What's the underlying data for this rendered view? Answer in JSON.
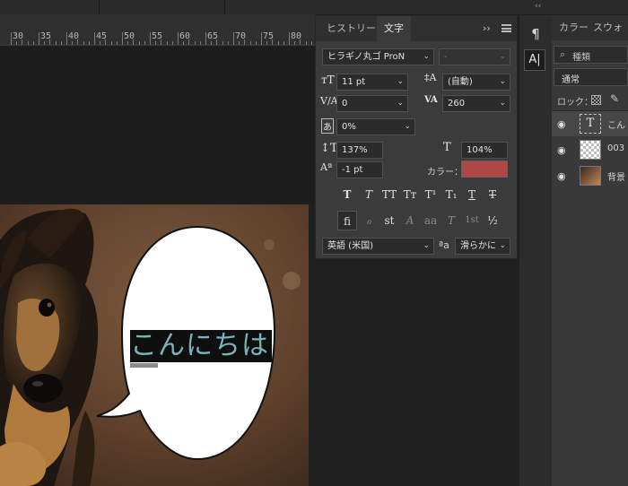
{
  "collapse_glyph": "‹‹",
  "ruler": {
    "labels": [
      "30",
      "35",
      "40",
      "45",
      "50",
      "55",
      "60",
      "65",
      "70",
      "75",
      "80"
    ]
  },
  "character_panel": {
    "tabs": {
      "history": "ヒストリー",
      "character": "文字"
    },
    "menu_glyph": "››",
    "font_family": "ヒラギノ丸ゴ ProN",
    "font_style": "-",
    "font_size": "11 pt",
    "leading": "(自動)",
    "kerning": "0",
    "tracking": "260",
    "tsume": "0%",
    "vertical_scale": "137%",
    "horizontal_scale": "104%",
    "baseline_shift": "-1 pt",
    "color_label": "カラー：",
    "text_color": "#b04646",
    "style_buttons": [
      "T",
      "T",
      "TT",
      "Tт",
      "T¹",
      "T₁",
      "T",
      "T"
    ],
    "opentype_buttons": [
      "ﬁ",
      "ℴ",
      "st",
      "A",
      "aa",
      "T",
      "1st",
      "½"
    ],
    "language": "英語 (米国)",
    "aa_label": "ªa",
    "antialias": "滑らかに"
  },
  "toolbar": {
    "tool1": "¶",
    "tool2": "A|"
  },
  "layers_panel": {
    "tabs": {
      "color": "カラー",
      "swatches": "スウォッ"
    },
    "filter_placeholder": "種類",
    "blend_mode": "通常",
    "lock_label": "ロック：",
    "layers": [
      {
        "name": "こん",
        "thumb_text": "T"
      },
      {
        "name": "003",
        "thumb_text": ""
      },
      {
        "name": "背景",
        "thumb_text": ""
      }
    ]
  },
  "canvas": {
    "bubble_text": "こんにちは"
  }
}
